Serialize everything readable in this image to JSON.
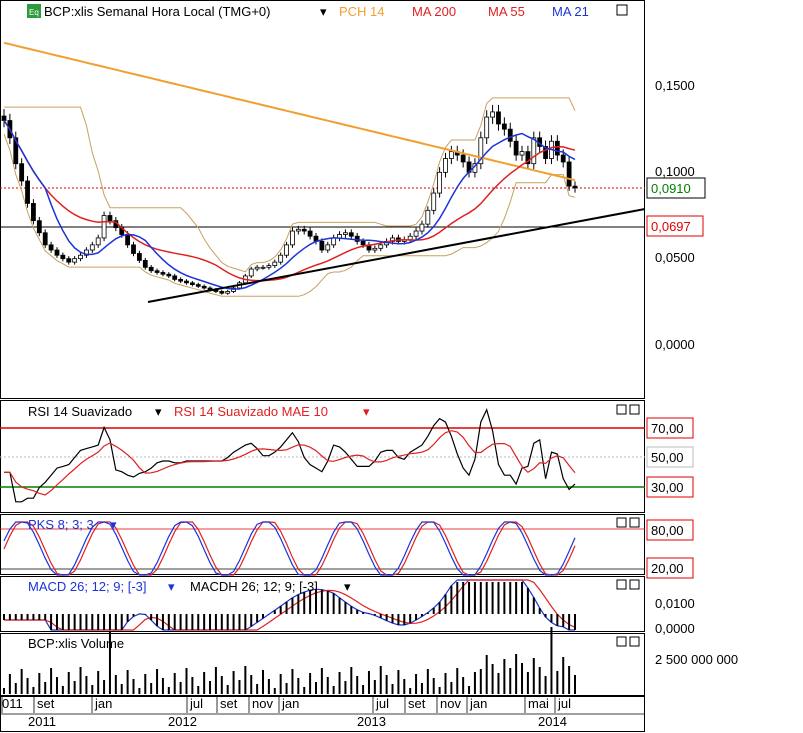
{
  "header": {
    "icon_text": "Eq",
    "title": "BCP:xlis Semanal Hora Local (TMG+0)",
    "indicators": [
      {
        "label": "PCH 14",
        "color": "#f0a030"
      },
      {
        "label": "MA 200",
        "color": "#f0a030"
      },
      {
        "label": "MA 55",
        "color": "#e02020"
      },
      {
        "label": "MA 21",
        "color": "#1c33d8"
      }
    ]
  },
  "price_axis": {
    "ticks": [
      "0,1500",
      "0,1000",
      "0,0500",
      "0,0000"
    ],
    "last_price": "0,0910",
    "support_price": "0,0697"
  },
  "rsi_panel": {
    "title_1": "RSI 14 Suavizado",
    "title_2": "RSI 14 Suavizado MAE 10",
    "levels": [
      "70,00",
      "50,00",
      "30,00"
    ]
  },
  "pks_panel": {
    "title": "PKS 8; 3; 3",
    "levels": [
      "80,00",
      "20,00"
    ]
  },
  "macd_panel": {
    "title_1": "MACD 26; 12; 9; [-3]",
    "title_2": "MACDH 26; 12; 9; [-3]",
    "ticks": [
      "0,0100",
      "0,0000"
    ]
  },
  "volume_panel": {
    "title": "BCP:xlis Volume",
    "ticks": [
      "2 500 000 000"
    ]
  },
  "time_axis": {
    "months": [
      "011",
      "set",
      "jan",
      "jul",
      "set",
      "nov",
      "jan",
      "jul",
      "set",
      "nov",
      "jan",
      "mai",
      "jul"
    ],
    "years": [
      "2011",
      "2012",
      "2013",
      "2014"
    ]
  },
  "chart_data": {
    "type": "candlestick",
    "symbol": "BCP:xlis",
    "period": "weekly",
    "close": [
      0.13,
      0.12,
      0.105,
      0.095,
      0.082,
      0.072,
      0.065,
      0.058,
      0.055,
      0.052,
      0.05,
      0.048,
      0.05,
      0.052,
      0.055,
      0.058,
      0.062,
      0.075,
      0.072,
      0.068,
      0.064,
      0.058,
      0.053,
      0.049,
      0.045,
      0.043,
      0.042,
      0.041,
      0.04,
      0.038,
      0.037,
      0.036,
      0.035,
      0.034,
      0.033,
      0.032,
      0.031,
      0.03,
      0.031,
      0.033,
      0.036,
      0.04,
      0.044,
      0.045,
      0.045,
      0.046,
      0.048,
      0.052,
      0.058,
      0.066,
      0.067,
      0.066,
      0.063,
      0.06,
      0.055,
      0.058,
      0.062,
      0.064,
      0.065,
      0.063,
      0.06,
      0.058,
      0.055,
      0.056,
      0.058,
      0.06,
      0.062,
      0.06,
      0.061,
      0.063,
      0.066,
      0.07,
      0.078,
      0.088,
      0.1,
      0.108,
      0.112,
      0.11,
      0.106,
      0.1,
      0.105,
      0.12,
      0.132,
      0.135,
      0.128,
      0.125,
      0.118,
      0.11,
      0.112,
      0.105,
      0.12,
      0.115,
      0.108,
      0.118,
      0.11,
      0.106,
      0.092,
      0.091
    ],
    "rsi_levels": [
      70,
      50,
      30
    ],
    "pks_levels": [
      80,
      20
    ],
    "y_range": [
      0.0,
      0.18
    ]
  }
}
